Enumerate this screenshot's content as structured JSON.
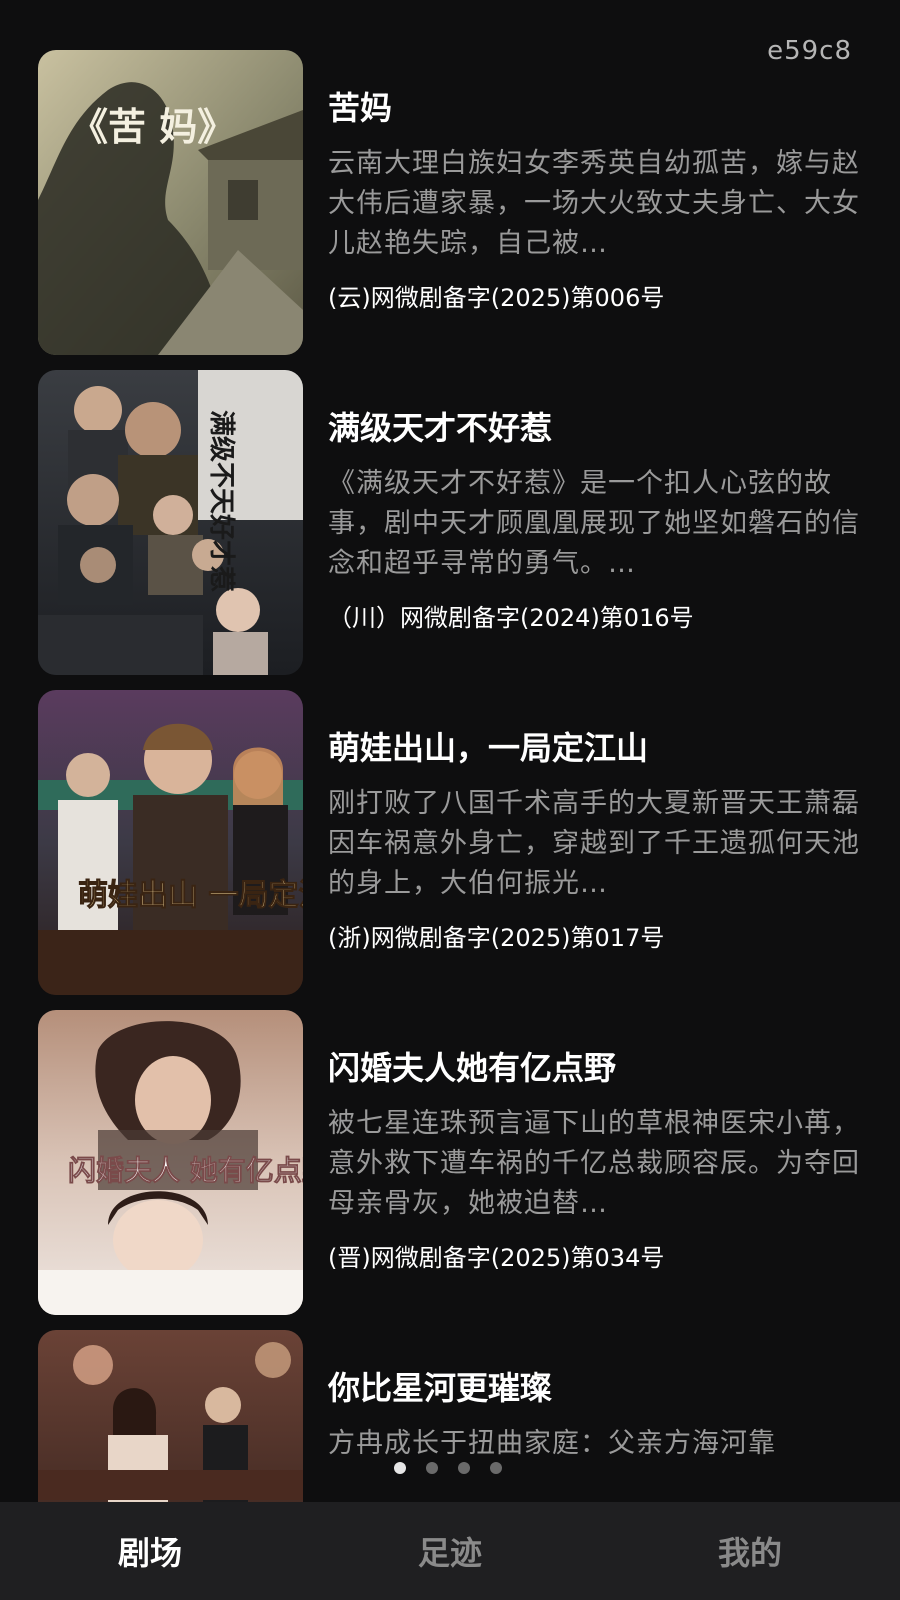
{
  "corner_id": "e59c8",
  "dramas": [
    {
      "title": "苦妈",
      "description": "云南大理白族妇女李秀英自幼孤苦，嫁与赵大伟后遭家暴，一场大火致丈夫身亡、大女儿赵艳失踪，自己被…",
      "license": "(云)网微剧备字(2025)第006号",
      "poster_text": "《苦 妈》"
    },
    {
      "title": "满级天才不好惹",
      "description": "《满级天才不好惹》是一个扣人心弦的故事，剧中天才顾凰凰展现了她坚如磐石的信念和超乎寻常的勇气。…",
      "license": "（川）网微剧备字(2024)第016号",
      "poster_text": "满级不天好才惹"
    },
    {
      "title": "萌娃出山，一局定江山",
      "description": "刚打败了八国千术高手的大夏新晋天王萧磊因车祸意外身亡，穿越到了千王遗孤何天池的身上，大伯何振光…",
      "license": "(浙)网微剧备字(2025)第017号",
      "poster_text": "萌娃出山 一局定江山"
    },
    {
      "title": "闪婚夫人她有亿点野",
      "description": "被七星连珠预言逼下山的草根神医宋小苒，意外救下遭车祸的千亿总裁顾容辰。为夺回母亲骨灰，她被迫替…",
      "license": "(晋)网微剧备字(2025)第034号",
      "poster_text": "闪婚夫人 她有亿点野"
    },
    {
      "title": "你比星河更璀璨",
      "description": "方冉成长于扭曲家庭：父亲方海河靠",
      "license": "",
      "poster_text": ""
    }
  ],
  "carousel": {
    "count": 4,
    "active_index": 0
  },
  "tabs": [
    {
      "label": "剧场",
      "active": true
    },
    {
      "label": "足迹",
      "active": false
    },
    {
      "label": "我的",
      "active": false
    }
  ]
}
